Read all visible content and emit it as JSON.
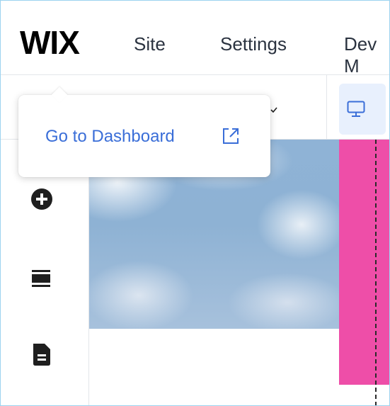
{
  "brand": {
    "logo_text": "WIX"
  },
  "top_menu": {
    "items": [
      {
        "label": "Site"
      },
      {
        "label": "Settings"
      },
      {
        "label": "Dev M"
      }
    ]
  },
  "toolbar": {
    "device_icon": "desktop-icon",
    "chevron_icon": "chevron-down-icon"
  },
  "sidebar": {
    "items": [
      {
        "icon": "add-circle-icon"
      },
      {
        "icon": "sections-icon"
      },
      {
        "icon": "pages-icon"
      }
    ]
  },
  "popover": {
    "link_label": "Go to Dashboard",
    "link_icon": "external-link-icon"
  },
  "colors": {
    "accent": "#3a6ed8",
    "pink_strip": "#ee4ea8",
    "device_button_bg": "#e8f0fd",
    "frame_border": "#9cd3f0"
  }
}
